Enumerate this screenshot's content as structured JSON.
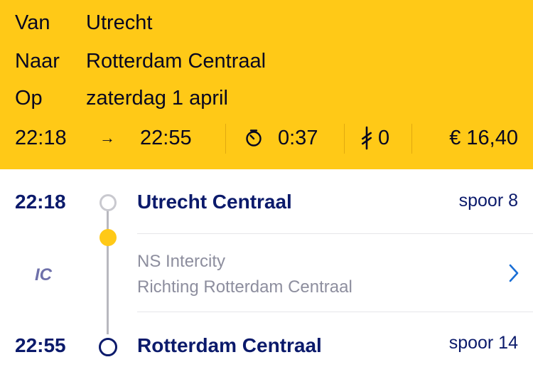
{
  "trip": {
    "from_label": "Van",
    "from_value": "Utrecht",
    "to_label": "Naar",
    "to_value": "Rotterdam Centraal",
    "date_label": "Op",
    "date_value": "zaterdag 1 april"
  },
  "summary": {
    "departure": "22:18",
    "arrow": "→",
    "arrival": "22:55",
    "duration": "0:37",
    "transfers": "0",
    "price": "€ 16,40"
  },
  "journey": {
    "origin": {
      "time": "22:18",
      "station": "Utrecht Centraal",
      "track": "spoor 8"
    },
    "leg": {
      "train_type": "IC",
      "operator": "NS Intercity",
      "direction": "Richting Rotterdam Centraal"
    },
    "destination": {
      "time": "22:55",
      "station": "Rotterdam Centraal",
      "track": "spoor 14"
    }
  },
  "colors": {
    "header_bg": "#FFC917",
    "primary_blue": "#0b1a6b",
    "secondary_text": "#8d8e9e",
    "accent_link": "#1a6fd6"
  },
  "icons": {
    "duration": "stopwatch-icon",
    "transfers": "transfer-icon",
    "leg_detail": "chevron-right-icon"
  }
}
